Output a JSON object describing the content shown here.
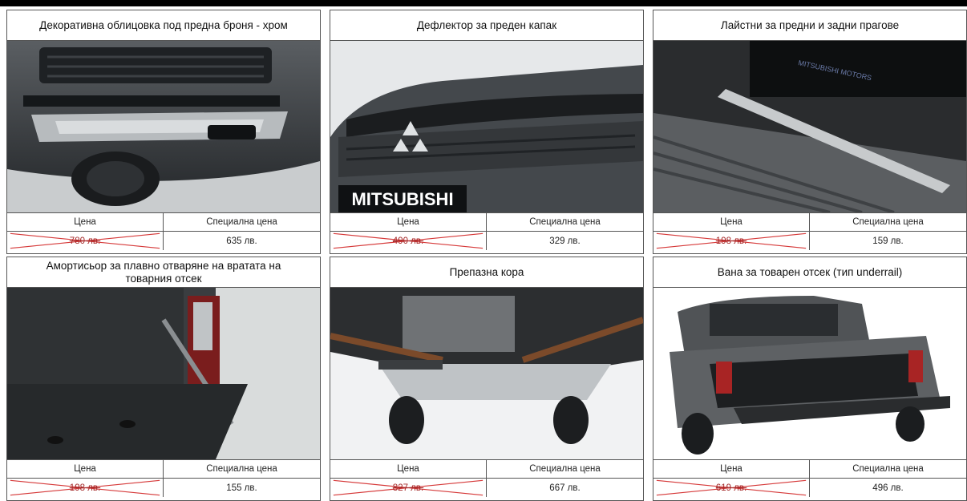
{
  "products": [
    {
      "title": "Декоративна облицовка под предна броня - хром",
      "price_label": "Цена",
      "special_label": "Специална цена",
      "old_price": "780 лв.",
      "special_price": "635 лв.",
      "image_icon": "chrome-bumper-trim-photo"
    },
    {
      "title": "Дефлектор за преден капак",
      "price_label": "Цена",
      "special_label": "Специална цена",
      "old_price": "490 лв.",
      "special_price": "329 лв.",
      "image_icon": "hood-deflector-photo",
      "badge": "MITSUBISHI"
    },
    {
      "title": "Лайстни за предни и задни прагове",
      "price_label": "Цена",
      "special_label": "Специална цена",
      "old_price": "198 лв.",
      "special_price": "159 лв.",
      "image_icon": "door-sill-photo"
    },
    {
      "title": "Амортисьор за плавно отваряне на вратата на товарния отсек",
      "price_label": "Цена",
      "special_label": "Специална цена",
      "old_price": "198 лв.",
      "special_price": "155 лв.",
      "image_icon": "tailgate-damper-photo"
    },
    {
      "title": "Препазна кора",
      "price_label": "Цена",
      "special_label": "Специална цена",
      "old_price": "827 лв.",
      "special_price": "667 лв.",
      "image_icon": "skid-plate-photo"
    },
    {
      "title": "Вана за товарен отсек (тип underrail)",
      "price_label": "Цена",
      "special_label": "Специална цена",
      "old_price": "619 лв.",
      "special_price": "496 лв.",
      "image_icon": "bed-liner-photo"
    }
  ],
  "colors": {
    "cross": "#d63a3a",
    "border": "#555555"
  }
}
